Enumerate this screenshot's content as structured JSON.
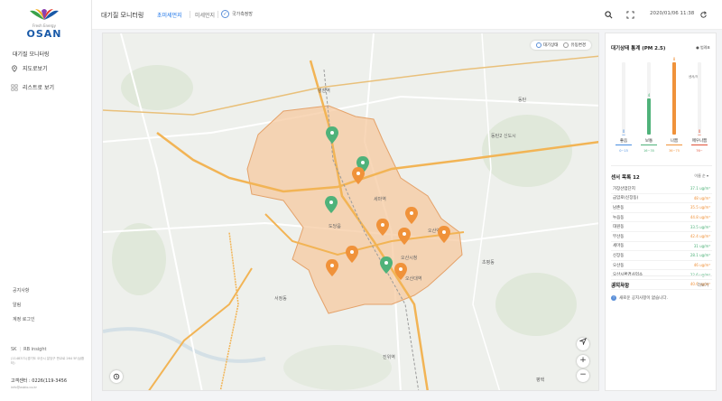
{
  "brand": {
    "tagline": "Fresh Energy",
    "name": "OSAN"
  },
  "sidebar": {
    "section_title": "대기질 모니터링",
    "items": [
      {
        "label": "지도로보기",
        "icon": "map-pin-icon"
      },
      {
        "label": "리스트로 보기",
        "icon": "grid-icon"
      }
    ],
    "links": [
      "공지사항",
      "알림",
      "계정 로그인"
    ],
    "partners": [
      "SK",
      "RB insight"
    ],
    "address": "(1148371)경기도 오산시 분당구 판교로 264 5F(삼환타)",
    "contact": "고객센터 : 0226(119-3456",
    "contact_sub": "info@osbio.co.kr"
  },
  "header": {
    "title": "대기질 모니터링",
    "tabs": [
      "초미세먼지",
      "미세먼지"
    ],
    "active_tab": 0,
    "check_label": "국가측정망",
    "datetime": "2020/01/06 11:38"
  },
  "map": {
    "toggle": {
      "on_label": "대기상태",
      "off_label": "유동변경"
    },
    "labels": [
      {
        "text": "병점역"
      },
      {
        "text": "동탄2 신도시"
      },
      {
        "text": "도당읍"
      },
      {
        "text": "오산시청"
      },
      {
        "text": "세마역"
      },
      {
        "text": "오산대역"
      },
      {
        "text": "오산역"
      },
      {
        "text": "진위역"
      },
      {
        "text": "동탄"
      },
      {
        "text": "평택"
      },
      {
        "text": "서정동"
      },
      {
        "text": "초평동"
      }
    ],
    "zoom_in": "+",
    "zoom_out": "−",
    "colors": {
      "region": "#f5c9a0",
      "good": "#4fb27a",
      "moderate": "#f0923a",
      "road": "#f2b455",
      "water": "#d4e0e6"
    }
  },
  "panel": {
    "stats_title": "대기상태 통계 (PM 2.5)",
    "stats_legend": "● 범례표",
    "chart_data": {
      "type": "bar",
      "categories": [
        "좋음",
        "보통",
        "나쁨",
        "매우나쁨"
      ],
      "values": [
        0,
        4,
        8,
        0
      ],
      "colors": [
        "#4a8ee0",
        "#4fb27a",
        "#f0923a",
        "#e0533a"
      ],
      "ranges": [
        "0~15",
        "16~35",
        "36~75",
        "76~"
      ],
      "annotation": "센서/개수",
      "ylim": [
        0,
        8
      ]
    },
    "sensor_title": "센서 목록 12",
    "sort_label": "이름 순 ▾",
    "sensors": [
      {
        "name": "가장산업단지",
        "value": "37.1 ug/m³",
        "color": "#4fb27a"
      },
      {
        "name": "금암로(신장동)",
        "value": "48 ug/m³",
        "color": "#f0923a"
      },
      {
        "name": "남촌동",
        "value": "35.5 ug/m³",
        "color": "#f0923a"
      },
      {
        "name": "누읍동",
        "value": "44.8 ug/m³",
        "color": "#f0923a"
      },
      {
        "name": "대원동",
        "value": "33.5 ug/m³",
        "color": "#4fb27a"
      },
      {
        "name": "부산동",
        "value": "42.4 ug/m³",
        "color": "#f0923a"
      },
      {
        "name": "세마동",
        "value": "31 ug/m³",
        "color": "#4fb27a"
      },
      {
        "name": "신장동",
        "value": "28.1 ug/m³",
        "color": "#4fb27a"
      },
      {
        "name": "오산동",
        "value": "46 ug/m³",
        "color": "#f0923a"
      },
      {
        "name": "오산시환경사업소",
        "value": "22.6 ug/m³",
        "color": "#4fb27a"
      },
      {
        "name": "중앙동",
        "value": "40.6 ug/m³",
        "color": "#f0923a"
      }
    ],
    "notice_title": "공지사항",
    "notice_more": "더보기",
    "notice_empty": "새로운 공지사항이 없습니다."
  }
}
